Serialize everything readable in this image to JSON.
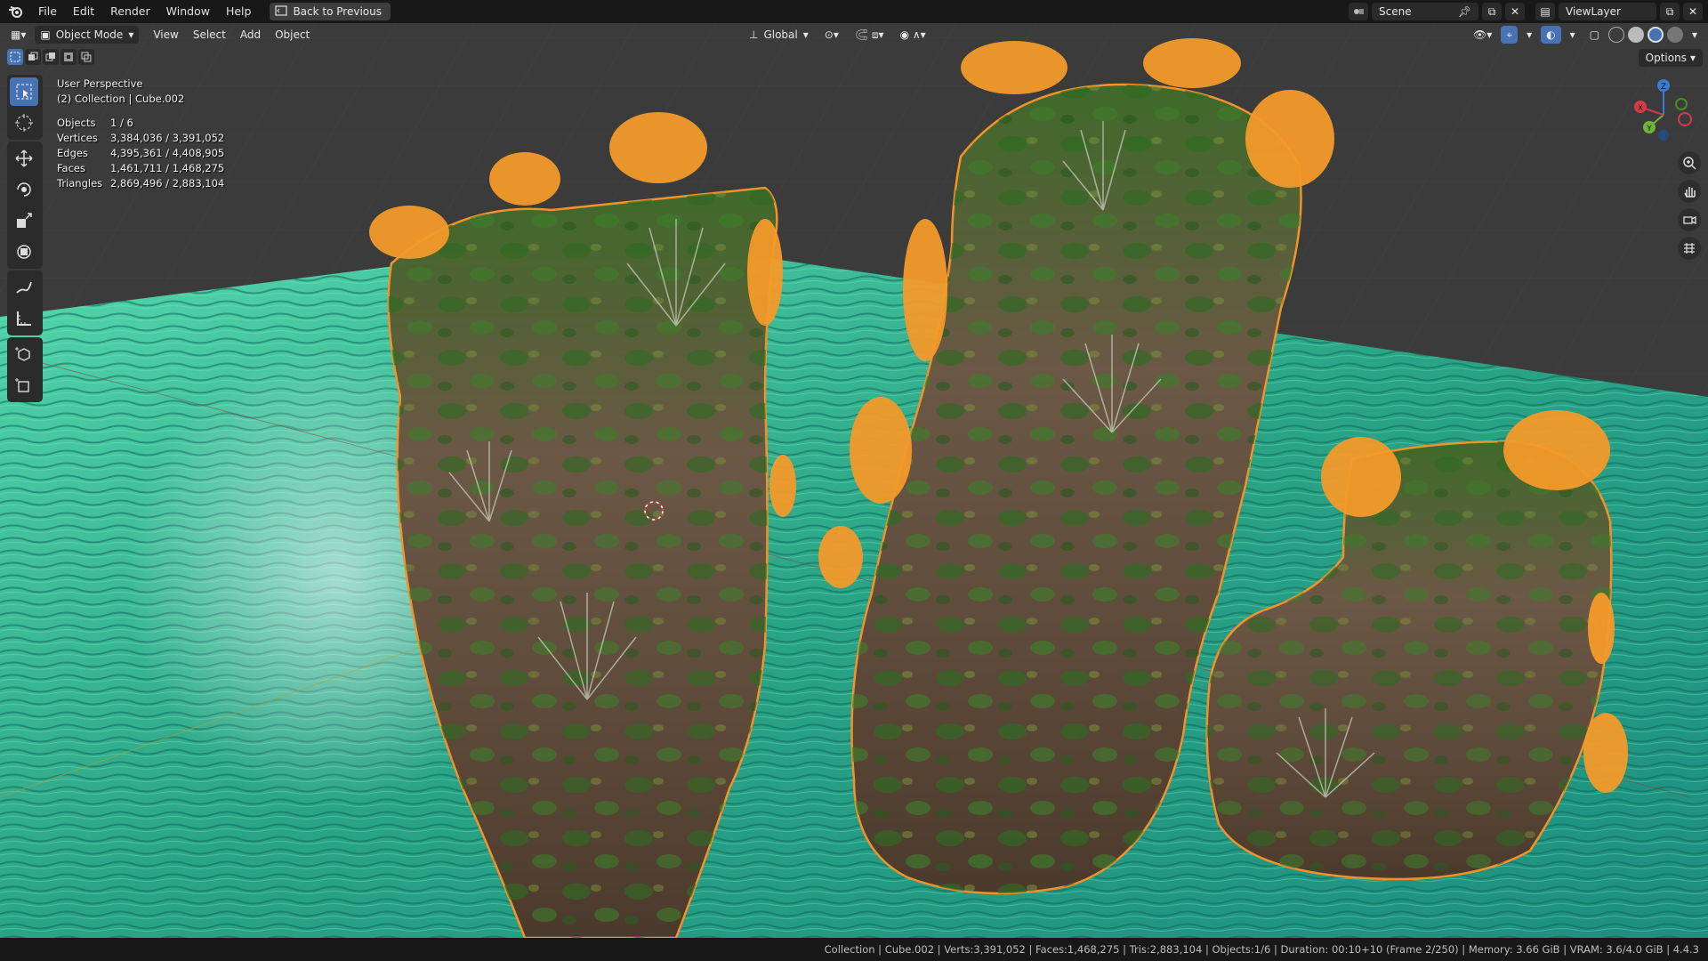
{
  "topbar": {
    "menus": [
      "File",
      "Edit",
      "Render",
      "Window",
      "Help"
    ],
    "back_button": "Back to Previous",
    "scene_name": "Scene",
    "view_layer": "ViewLayer"
  },
  "header": {
    "mode": "Object Mode",
    "menus": [
      "View",
      "Select",
      "Add",
      "Object"
    ],
    "transform_orientation": "Global",
    "options_label": "Options"
  },
  "overlay": {
    "perspective": "User Perspective",
    "collection": "(2) Collection | Cube.002",
    "stats": [
      {
        "key": "Objects",
        "value": "1 / 6"
      },
      {
        "key": "Vertices",
        "value": "3,384,036 / 3,391,052"
      },
      {
        "key": "Edges",
        "value": "4,395,361 / 4,408,905"
      },
      {
        "key": "Faces",
        "value": "1,461,711 / 1,468,275"
      },
      {
        "key": "Triangles",
        "value": "2,869,496 / 2,883,104"
      }
    ]
  },
  "gizmo": {
    "z": "Z",
    "y": "Y",
    "x": "X"
  },
  "statusbar": {
    "text": "Collection | Cube.002 | Verts:3,391,052 | Faces:1,468,275 | Tris:2,883,104 | Objects:1/6 | Duration: 00:10+10 (Frame 2/250) | Memory: 3.66 GiB | VRAM: 3.6/4.0 GiB | 4.4.3"
  },
  "colors": {
    "selection_outline": "#f0932b",
    "water": "#2ea887",
    "grid_bg": "#3a3a3a",
    "active_blue": "#4772b3"
  },
  "icons": [
    "blender-logo-icon",
    "back-icon",
    "scene-icon",
    "viewlayer-icon",
    "select-box-icon",
    "cursor-icon",
    "move-icon",
    "rotate-icon",
    "scale-icon",
    "transform-icon",
    "annotate-icon",
    "measure-icon",
    "add-cube-icon",
    "zoom-icon",
    "hand-icon",
    "camera-icon",
    "grid-icon"
  ]
}
